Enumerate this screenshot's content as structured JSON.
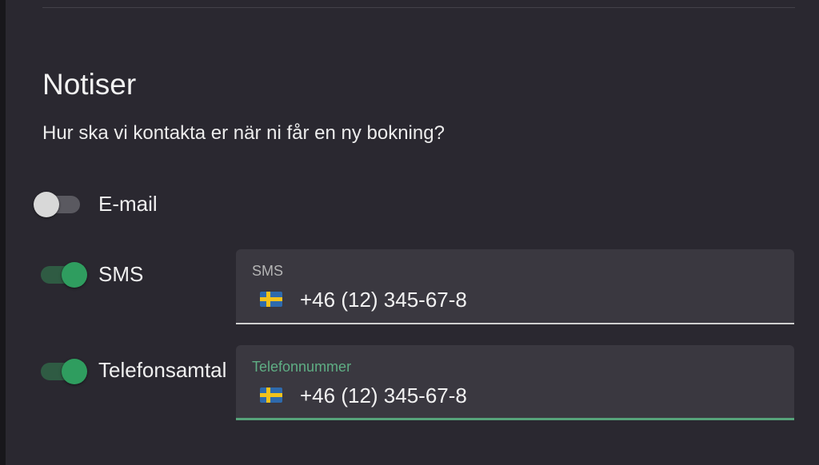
{
  "notifications": {
    "title": "Notiser",
    "subtitle": "Hur ska vi kontakta er när ni får en ny bokning?",
    "email": {
      "label": "E-mail",
      "enabled": false
    },
    "sms": {
      "label": "SMS",
      "enabled": true,
      "field_label": "SMS",
      "value": "+46 (12) 345-67-8",
      "flag": "sweden-flag-icon"
    },
    "phone": {
      "label": "Telefonsamtal",
      "enabled": true,
      "field_label": "Telefonnummer",
      "value": "+46 (12) 345-67-8",
      "flag": "sweden-flag-icon",
      "focused": true
    }
  },
  "colors": {
    "accent": "#2f9d5f",
    "focus_accent": "#5fae84",
    "background": "#2a2830",
    "field_background": "#3a3840",
    "flag_blue": "#2e6aad",
    "flag_yellow": "#f2c21b"
  }
}
